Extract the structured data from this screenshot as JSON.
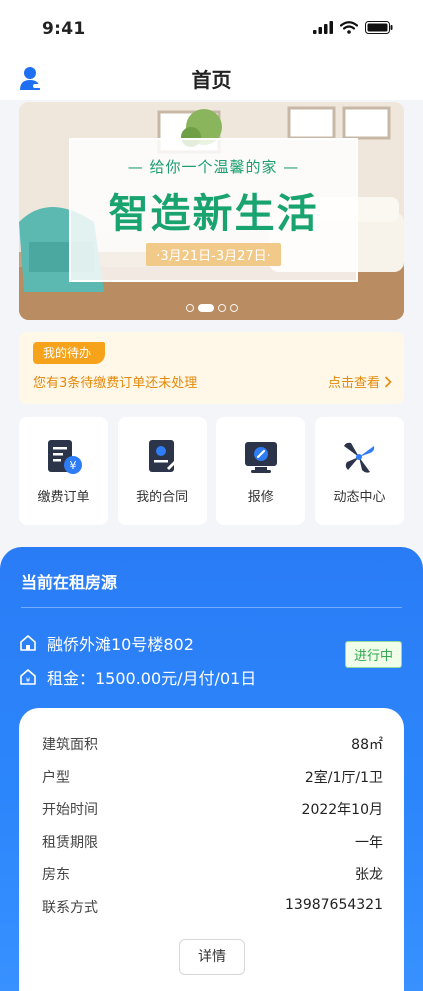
{
  "status_bar": {
    "time": "9:41"
  },
  "nav": {
    "title": "首页"
  },
  "banner": {
    "subtitle": "— 给你一个温馨的家 —",
    "headline": "智造新生活",
    "date_range": "·3月21日-3月27日·",
    "slides": 4,
    "active_slide": 2
  },
  "todo": {
    "badge": "我的待办",
    "message": "您有3条待缴费订单还未处理",
    "link": "点击查看"
  },
  "quick_actions": [
    {
      "label": "缴费订单",
      "icon": "payment-order-icon"
    },
    {
      "label": "我的合同",
      "icon": "contract-icon"
    },
    {
      "label": "报修",
      "icon": "repair-icon"
    },
    {
      "label": "动态中心",
      "icon": "news-center-icon"
    }
  ],
  "rental": {
    "title": "当前在租房源",
    "address": "融侨外滩10号楼802",
    "rent": "租金：1500.00元/月付/01日",
    "status": "进行中"
  },
  "details": [
    {
      "key": "建筑面积",
      "value": "88㎡"
    },
    {
      "key": "户型",
      "value": "2室/1厅/1卫"
    },
    {
      "key": "开始时间",
      "value": "2022年10月"
    },
    {
      "key": "租赁期限",
      "value": "一年"
    },
    {
      "key": "房东",
      "value": "张龙"
    },
    {
      "key": "联系方式",
      "value": "13987654321"
    }
  ],
  "detail_button": "详情",
  "colors": {
    "primary_blue": "#2a7cf6",
    "accent_orange": "#f7a21b",
    "status_green": "#32a852"
  }
}
